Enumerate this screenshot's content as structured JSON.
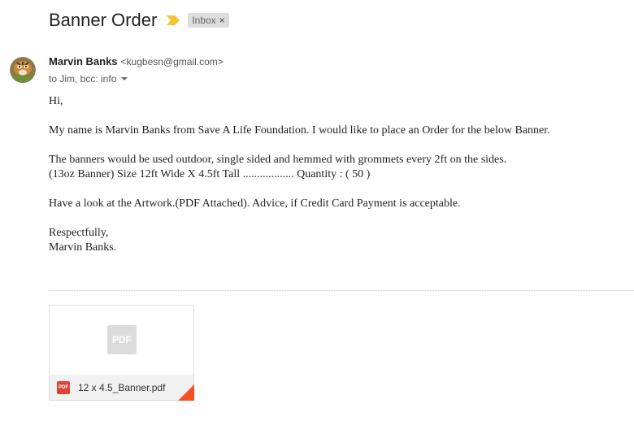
{
  "email": {
    "subject": "Banner Order",
    "label": "Inbox",
    "label_remove": "×",
    "sender_name": "Marvin Banks",
    "sender_email": "<kugbesn@gmail.com>",
    "recipients": "to Jim, bcc: info",
    "body": [
      "Hi,",
      "My name is Marvin Banks from Save A Life Foundation. I would like to place an Order for the below Banner.",
      "The banners would be used outdoor, single sided and hemmed with grommets every 2ft on the sides.",
      "(13oz Banner)  Size 12ft Wide X 4.5ft Tall .................. Quantity : ( 50 )",
      "Have a look at the Artwork.(PDF Attached).  Advice, if Credit Card Payment is acceptable.",
      "Respectfully,",
      "Marvin Banks."
    ]
  },
  "attachment": {
    "preview_label": "PDF",
    "icon_label": "PDF",
    "filename": "12 x 4.5_Banner.pdf"
  },
  "icons": {
    "importance": "importance-marker-icon",
    "avatar": "avatar",
    "caret": "chevron-down-icon",
    "pdf": "pdf-icon"
  },
  "colors": {
    "importance": "#f4c430",
    "label_bg": "#dddddd",
    "pdf_red": "#db4437",
    "corner": "#f4511e"
  }
}
